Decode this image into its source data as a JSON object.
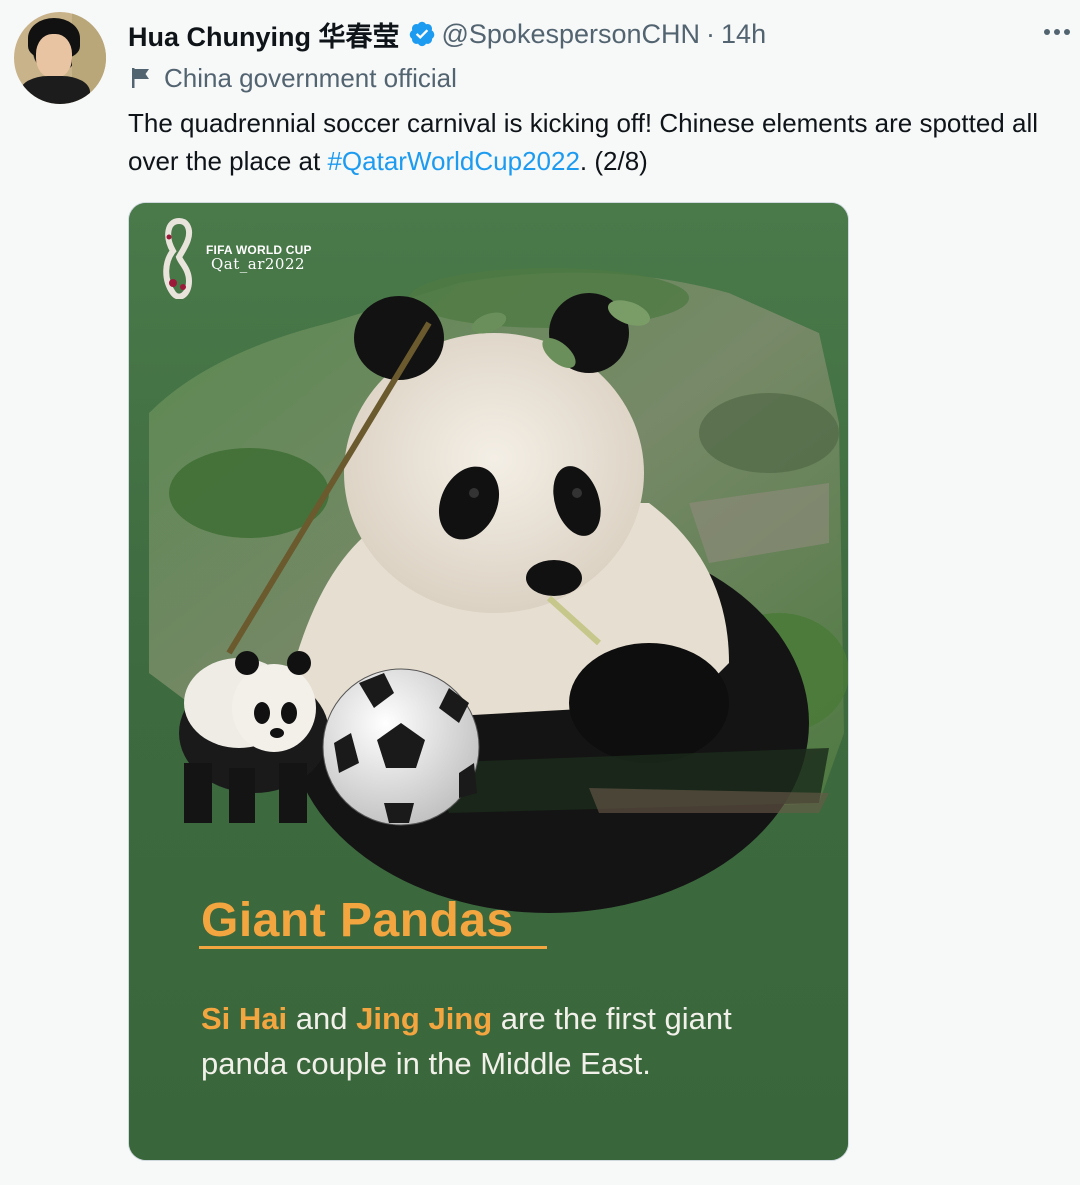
{
  "tweet": {
    "author_name": "Hua Chunying 华春莹",
    "handle": "@SpokespersonCHN",
    "separator": "·",
    "time": "14h",
    "label": "China government official",
    "text_part1": "The quadrennial soccer carnival is kicking off! Chinese elements are spotted all over the place at ",
    "hashtag": "#QatarWorldCup2022",
    "text_part2": ". (2/8)"
  },
  "media": {
    "logo_line1": "FIFA WORLD CUP",
    "logo_line2": "Qat_ar2022",
    "title": "Giant Pandas",
    "name1": "Si Hai",
    "and": " and ",
    "name2": "Jing Jing",
    "body_rest": " are the first giant panda couple in the Middle East."
  },
  "colors": {
    "link": "#1d9bf0",
    "verified": "#1d9bf0",
    "card_green": "#3f6b41",
    "highlight_orange": "#f3a53f"
  },
  "icons": [
    "avatar",
    "verified-badge-icon",
    "more-options-icon",
    "government-flag-icon",
    "fifa-logo"
  ]
}
